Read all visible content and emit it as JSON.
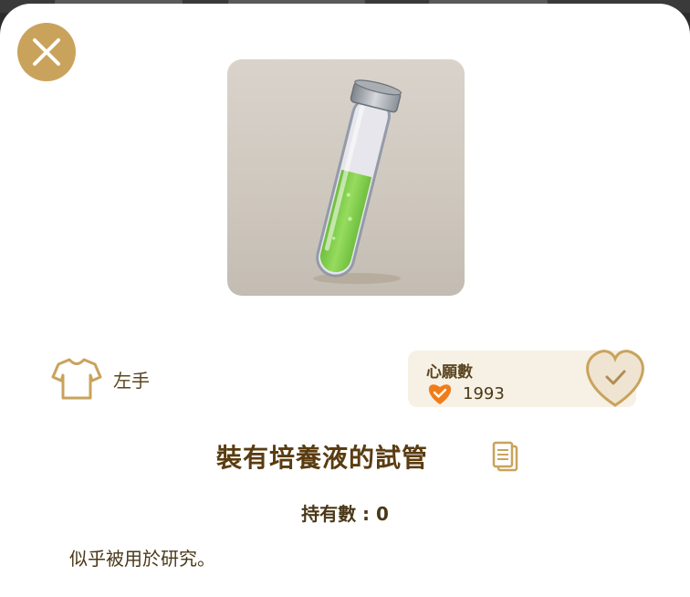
{
  "item": {
    "name": "裝有培養液的試管",
    "owned_label": "持有數 : 0",
    "description": "似乎被用於研究。",
    "image_icon": "test-tube-with-green-liquid"
  },
  "slot": {
    "label": "左手",
    "icon": "shirt-icon"
  },
  "wish": {
    "title": "心願數",
    "count": "1993",
    "icon": "orange-heart-check-icon"
  },
  "buttons": {
    "close_icon": "close-icon",
    "wish_heart_icon": "heart-check-icon",
    "detail_icon": "document-icon"
  },
  "colors": {
    "gold": "#c9a35c",
    "brown_text": "#5a4520",
    "wish_bg": "#f7f0e4",
    "orange": "#f07d1a",
    "liquid_green": "#8fd45a"
  }
}
